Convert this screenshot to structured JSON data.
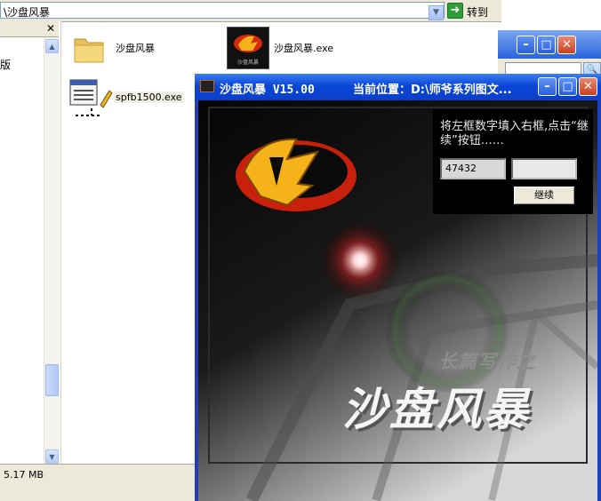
{
  "explorer": {
    "address": "\\沙盘风暴",
    "go_label": "转到",
    "left_pane_text": "版",
    "status_size": "5.17 MB",
    "files": [
      {
        "name": "沙盘风暴",
        "icon": "folder-icon"
      },
      {
        "name": "沙盘风暴.exe",
        "icon": "app-icon"
      },
      {
        "name": "spfb1500.exe",
        "icon": "installer-icon"
      }
    ]
  },
  "splash": {
    "title": "沙盘风暴 V15.00",
    "location": "当前位置：D:\\师爷系列图文...",
    "instruction": "将左框数字填入右框,点击“继续”按钮……",
    "code": "47432",
    "input_value": "",
    "continue_label": "继续",
    "subtitle": "长篇写作之",
    "big_title": "沙盘风暴"
  },
  "colors": {
    "xp_title": "#0a46d6",
    "logo_red": "#d42a0e",
    "logo_gold": "#f6b21a"
  }
}
